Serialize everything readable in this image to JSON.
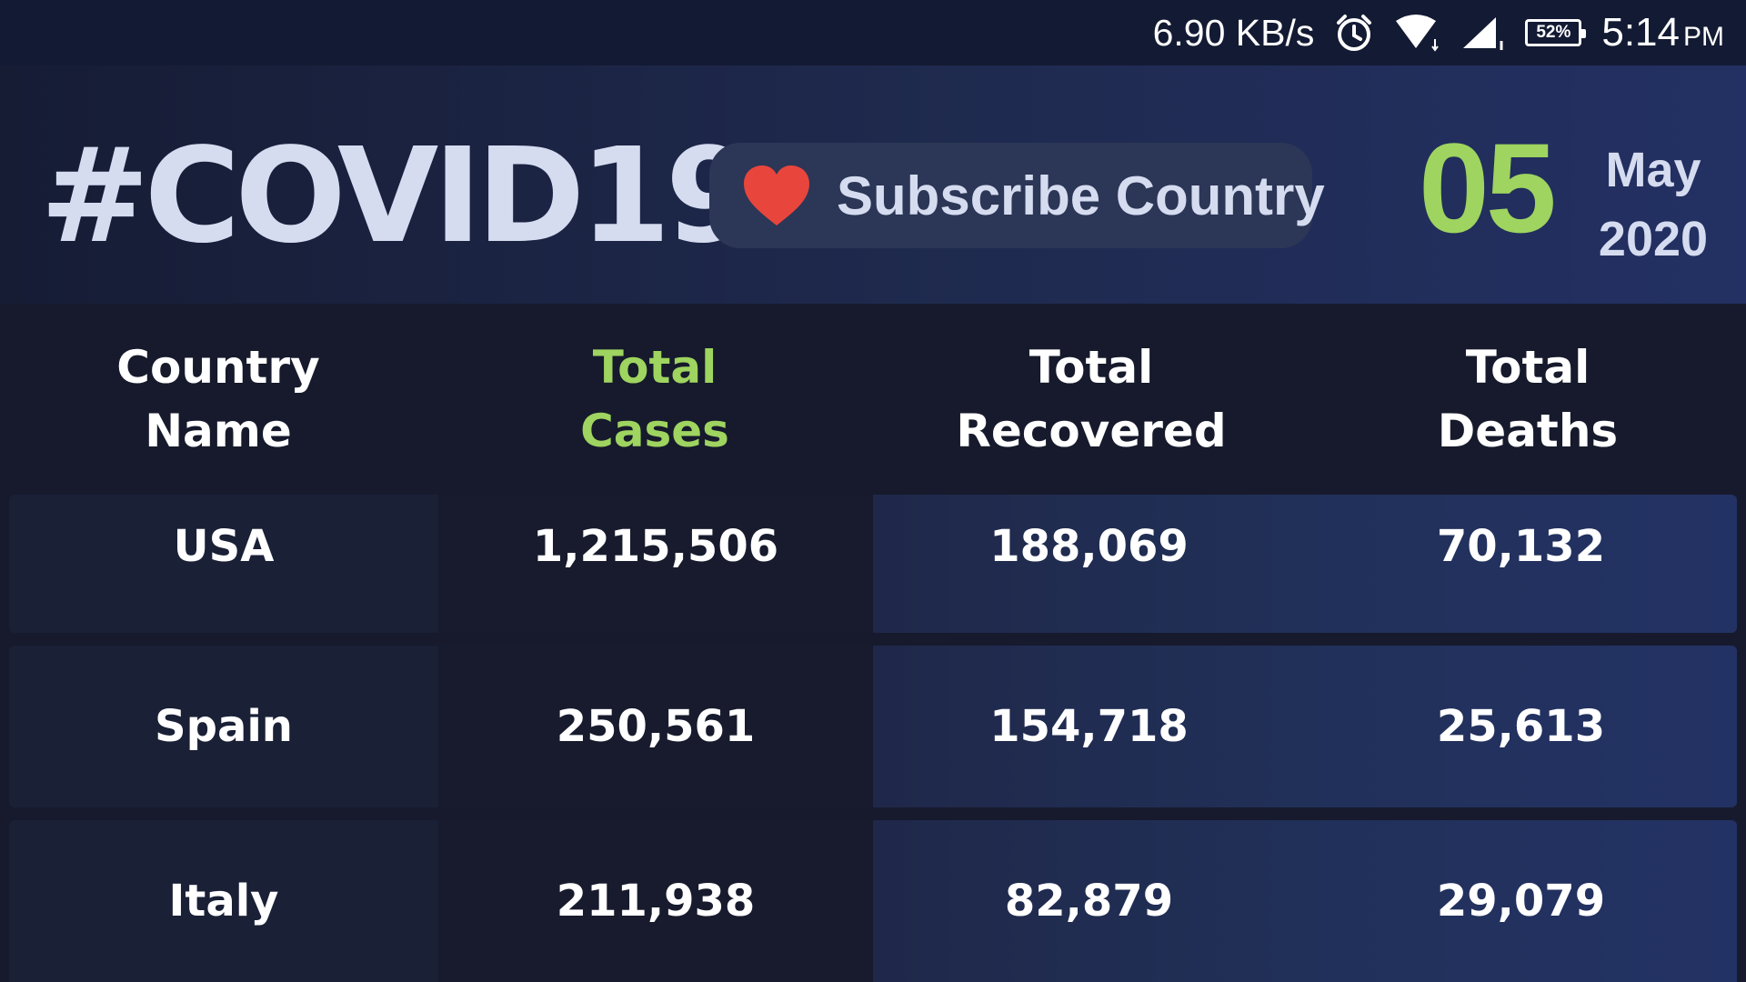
{
  "status_bar": {
    "net_speed": "6.90 KB/s",
    "battery": "52%",
    "time": "5:14",
    "ampm": "PM",
    "icons": [
      "alarm-icon",
      "wifi-icon",
      "cell-signal-icon",
      "battery-icon"
    ]
  },
  "header": {
    "hashtag": "#COVID19",
    "subscribe_label": "Subscribe Country",
    "date": {
      "day": "05",
      "month": "May",
      "year": "2020"
    }
  },
  "colors": {
    "accent_green": "#9ed45f",
    "heart_red": "#e8453c",
    "text_light": "#d5dcf0"
  },
  "table": {
    "headers": [
      "Country\nName",
      "Total\nCases",
      "Total\nRecovered",
      "Total\nDeaths"
    ],
    "rows": [
      {
        "country": "USA",
        "cases": "1,215,506",
        "recovered": "188,069",
        "deaths": "70,132"
      },
      {
        "country": "Spain",
        "cases": "250,561",
        "recovered": "154,718",
        "deaths": "25,613"
      },
      {
        "country": "Italy",
        "cases": "211,938",
        "recovered": "82,879",
        "deaths": "29,079"
      }
    ]
  }
}
